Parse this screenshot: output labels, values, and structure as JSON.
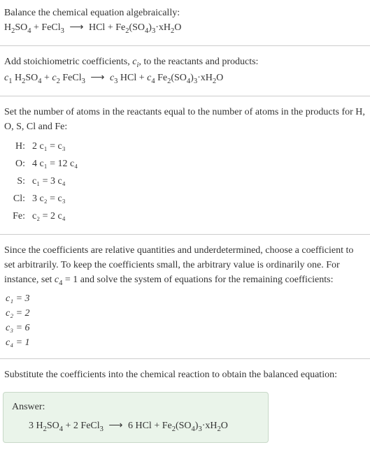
{
  "section1": {
    "title": "Balance the chemical equation algebraically:",
    "eq_lhs1": "H",
    "eq_lhs2": "SO",
    "eq_plus1": " + FeCl",
    "eq_arrow": " ⟶ ",
    "eq_rhs1": "HCl + Fe",
    "eq_rhs2": "(SO",
    "eq_rhs3": ")",
    "eq_rhs4": "·xH",
    "eq_rhs5": "O"
  },
  "section2": {
    "title_a": "Add stoichiometric coefficients, ",
    "title_c": "c",
    "title_i": "i",
    "title_b": ", to the reactants and products:",
    "c1": "c",
    "c1n": "1",
    "t1": " H",
    "t2": "SO",
    "t3": " + ",
    "c2": "c",
    "c2n": "2",
    "t4": " FeCl",
    "arrow": " ⟶ ",
    "c3": "c",
    "c3n": "3",
    "t5": " HCl + ",
    "c4": "c",
    "c4n": "4",
    "t6": " Fe",
    "t7": "(SO",
    "t8": ")",
    "t9": "·xH",
    "t10": "O"
  },
  "section3": {
    "title": "Set the number of atoms in the reactants equal to the number of atoms in the products for H, O, S, Cl and Fe:",
    "rows": [
      {
        "label": "H:",
        "eq": "2 c₁ = c₃"
      },
      {
        "label": "O:",
        "eq": "4 c₁ = 12 c₄"
      },
      {
        "label": "S:",
        "eq": "c₁ = 3 c₄"
      },
      {
        "label": "Cl:",
        "eq": "3 c₂ = c₃"
      },
      {
        "label": "Fe:",
        "eq": "c₂ = 2 c₄"
      }
    ]
  },
  "section4": {
    "title_a": "Since the coefficients are relative quantities and underdetermined, choose a coefficient to set arbitrarily. To keep the coefficients small, the arbitrary value is ordinarily one. For instance, set ",
    "title_c": "c",
    "title_n": "4",
    "title_b": " = 1 and solve the system of equations for the remaining coefficients:",
    "coefs": [
      "c₁ = 3",
      "c₂ = 2",
      "c₃ = 6",
      "c₄ = 1"
    ]
  },
  "section5": {
    "title": "Substitute the coefficients into the chemical reaction to obtain the balanced equation:"
  },
  "answer": {
    "label": "Answer:",
    "t1": "3 H",
    "t2": "SO",
    "t3": " + 2 FeCl",
    "arrow": " ⟶ ",
    "t4": "6 HCl + Fe",
    "t5": "(SO",
    "t6": ")",
    "t7": "·xH",
    "t8": "O"
  },
  "sub2": "2",
  "sub3": "3",
  "sub4": "4"
}
